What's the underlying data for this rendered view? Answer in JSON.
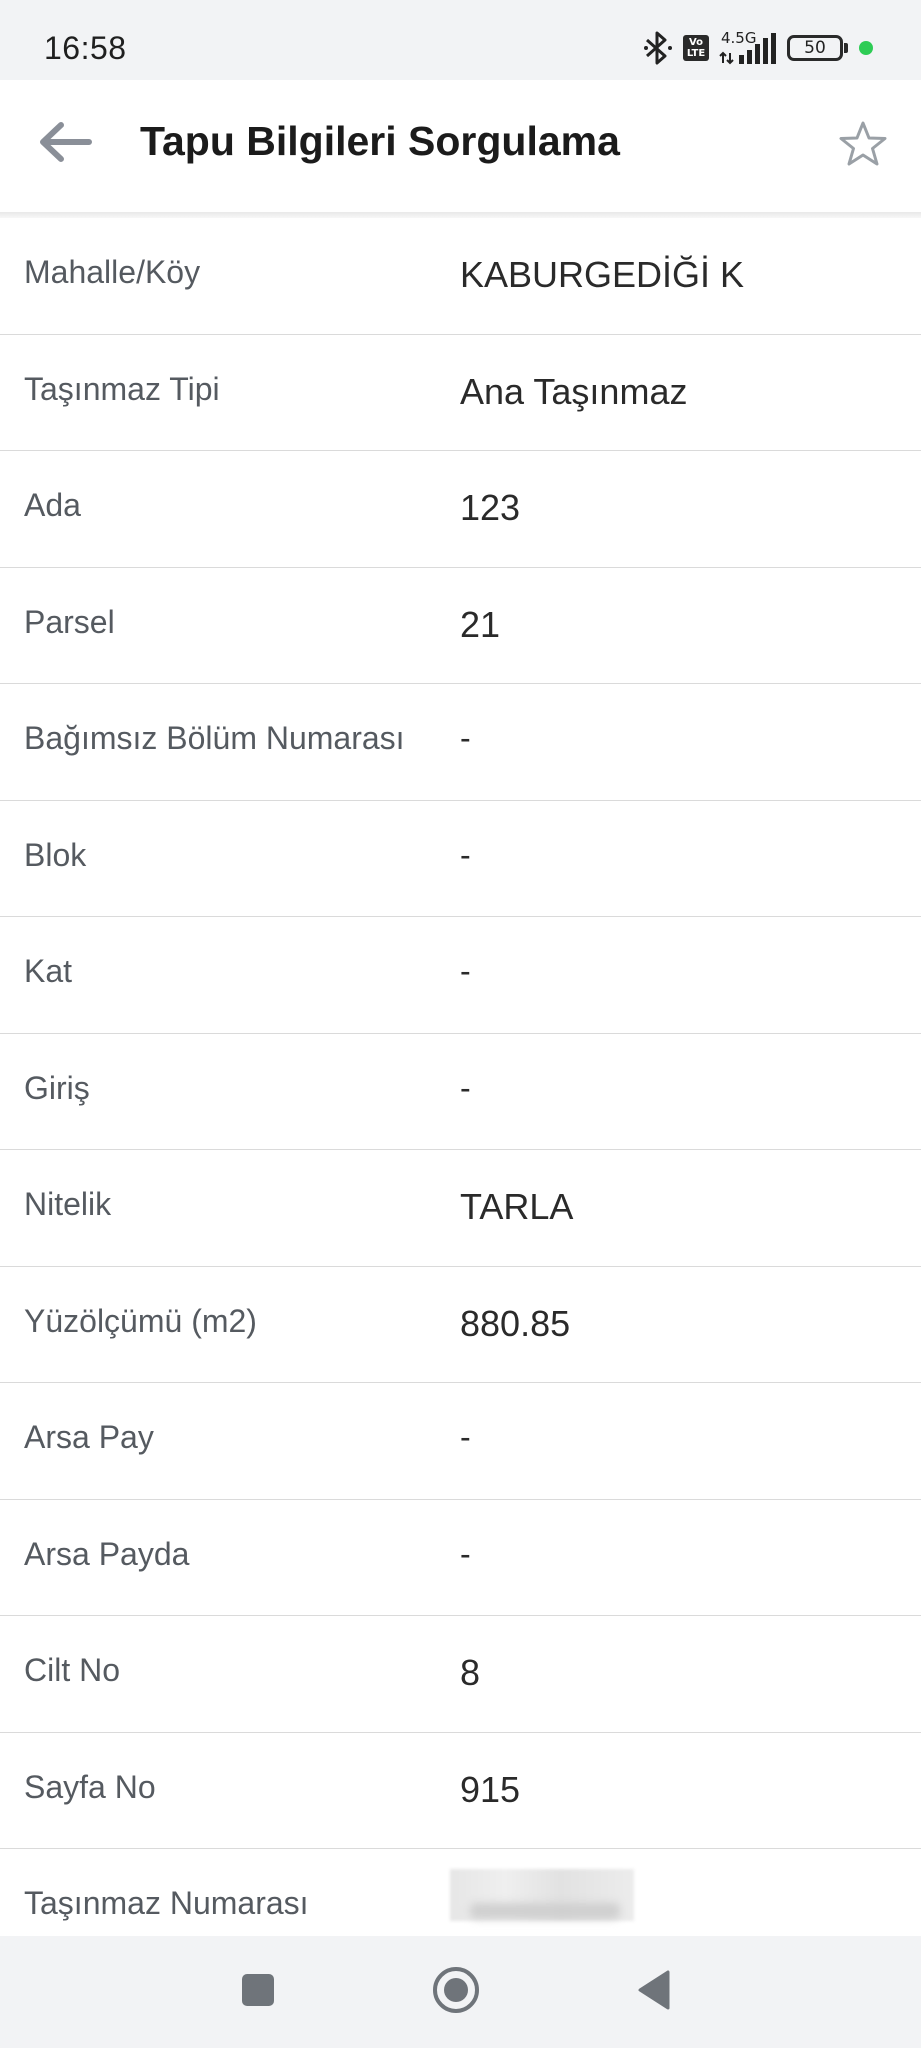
{
  "status_bar": {
    "time": "16:58",
    "network_type": "4.5G",
    "volte_label": "Vo LTE",
    "battery": "50",
    "icons": [
      "bluetooth-icon",
      "volte-icon",
      "signal-icon",
      "battery-icon",
      "green-dot"
    ]
  },
  "header": {
    "title": "Tapu Bilgileri Sorgulama",
    "back_icon": "arrow-left-icon",
    "favorite_icon": "star-outline-icon"
  },
  "rows": [
    {
      "label": "Mahalle/Köy",
      "value": "KABURGEDİĞİ K"
    },
    {
      "label": "Taşınmaz Tipi",
      "value": "Ana Taşınmaz"
    },
    {
      "label": "Ada",
      "value": "123"
    },
    {
      "label": "Parsel",
      "value": "21"
    },
    {
      "label": "Bağımsız Bölüm Numarası",
      "value": "-"
    },
    {
      "label": "Blok",
      "value": "-"
    },
    {
      "label": "Kat",
      "value": "-"
    },
    {
      "label": "Giriş",
      "value": "-"
    },
    {
      "label": "Nitelik",
      "value": "TARLA"
    },
    {
      "label": "Yüzölçümü (m2)",
      "value": "880.85"
    },
    {
      "label": "Arsa Pay",
      "value": "-"
    },
    {
      "label": "Arsa Payda",
      "value": "-"
    },
    {
      "label": "Cilt No",
      "value": "8"
    },
    {
      "label": "Sayfa No",
      "value": "915"
    },
    {
      "label": "Taşınmaz Numarası",
      "value": null
    }
  ],
  "nav_bar": {
    "icons": [
      "square-recents-icon",
      "circle-home-icon",
      "triangle-back-icon"
    ]
  },
  "colors": {
    "status_bar_bg": "#f2f3f5",
    "nav_bar_bg": "#f2f3f5",
    "divider": "#dadada",
    "label_text": "#555a60",
    "value_text": "#2a2a2a",
    "battery_dot": "#2ecc55",
    "icon_gray": "#8a8f98"
  }
}
